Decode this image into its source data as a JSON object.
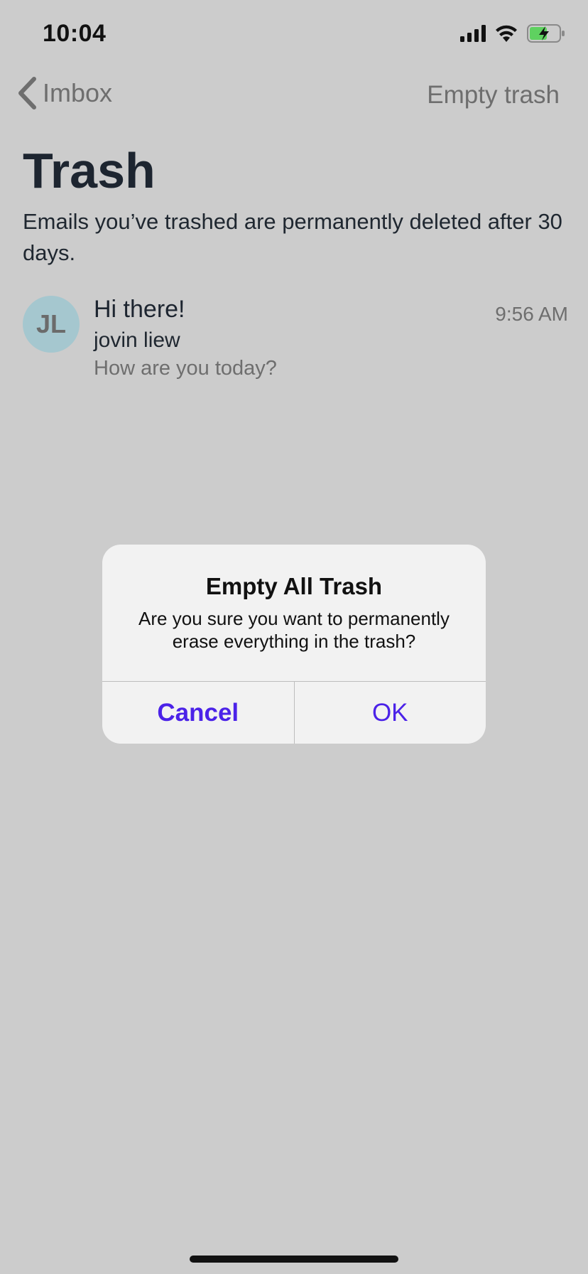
{
  "status_bar": {
    "time": "10:04",
    "icons": [
      "signal-bars-icon",
      "wifi-icon",
      "battery-charging-icon"
    ],
    "battery_fill_color": "#5fd160"
  },
  "nav": {
    "back_label": "Imbox",
    "back_icon": "chevron-left-icon",
    "action_label": "Empty trash"
  },
  "page": {
    "title": "Trash",
    "subtitle": "Emails you’ve trashed are permanently deleted after 30 days."
  },
  "emails": [
    {
      "avatar_initials": "JL",
      "avatar_color": "#a5c7cf",
      "subject": "Hi there!",
      "sender": "jovin liew",
      "preview": "How are you today?",
      "time": "9:56 AM"
    }
  ],
  "alert": {
    "title": "Empty All Trash",
    "message": "Are you sure you want to permanently erase everything in the trash?",
    "cancel_label": "Cancel",
    "ok_label": "OK",
    "accent_color": "#4b22e8"
  },
  "colors": {
    "background": "#cccccc",
    "alert_background": "#f2f2f2"
  }
}
